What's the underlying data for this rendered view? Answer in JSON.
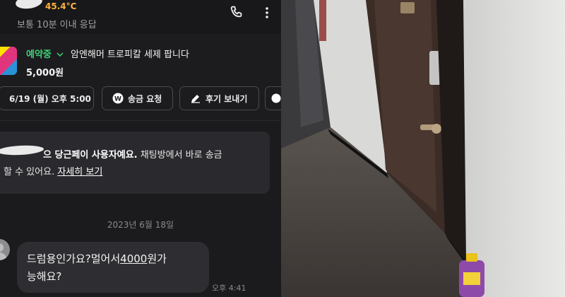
{
  "header": {
    "temperature": "45.4°C",
    "response_info": "보통 10분 이내 응답",
    "call_icon": "phone-icon",
    "menu_icon": "more-vertical-icon"
  },
  "product": {
    "status": "예약중",
    "title": "암엔해머 트로피칼 세제 팝니다",
    "price": "5,000원"
  },
  "actions": [
    {
      "label": "6/19 (월) 오후 5:00",
      "icon": "calendar-icon"
    },
    {
      "label": "송금 요청",
      "icon": "won-coin-icon"
    },
    {
      "label": "후기 보내기",
      "icon": "pencil-icon"
    }
  ],
  "notice": {
    "line1_bold": "으 당근페이 사용자예요.",
    "line1_rest": " 채팅방에서 바로 송금",
    "line2": "할 수 있어요. ",
    "link": "자세히 보기"
  },
  "messages": {
    "date": "2023년 6월 18일",
    "incoming": {
      "part1": "드럼용인가요?멀어서",
      "amount": "4000",
      "part2": "원가",
      "line2": "능해요?",
      "time": "오후 4:41"
    }
  },
  "colors": {
    "accent_green": "#3fcf78",
    "temperature_orange": "#ffb23f",
    "background": "#1b1b1d"
  }
}
